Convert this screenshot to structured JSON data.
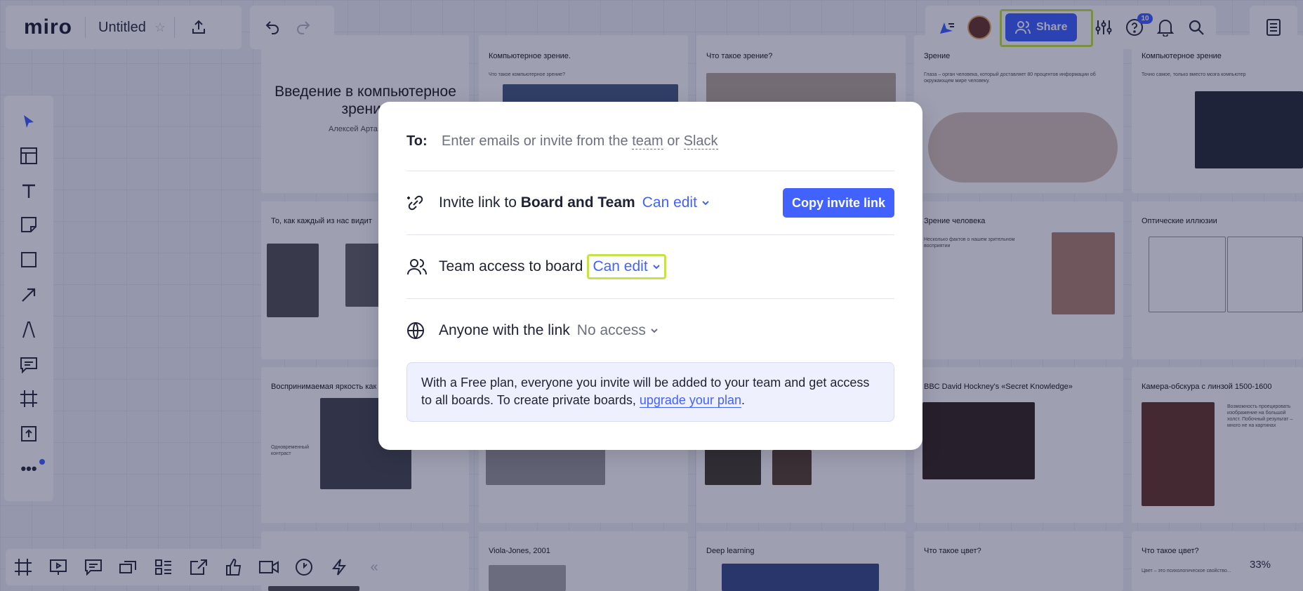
{
  "app": {
    "logo": "miro",
    "board_title": "Untitled",
    "notifications_count": "10",
    "share_label": "Share",
    "zoom": "33%"
  },
  "frames": [
    {
      "title": "Введение в компьютерное зрение",
      "subtitle": "Алексей Арта"
    },
    {
      "title": "Компьютерное зрение.",
      "subtitle": "Что такое компьютерное зрение?"
    },
    {
      "title": "Что такое зрение?"
    },
    {
      "title": "Зрение",
      "subtitle": "Глаза – орган человека, который доставляет 80 процентов информации об окружающем мире человеку."
    },
    {
      "title": "Компьютерное зрение",
      "subtitle": "Точно самое, только вместо мозга компьютер"
    },
    {
      "title": "То, как каждый из нас видит"
    },
    {
      "title": "Зрение человека",
      "subtitle": "Несколько фактов о нашем зрительном восприятии"
    },
    {
      "title": "Оптические иллюзии"
    },
    {
      "title": "Воспринимаемая яркость как фу",
      "subtitle": "Одновременный контраст"
    },
    {
      "title": "BBC David Hockney's «Secret Knowledge»"
    },
    {
      "title": "Камера-обскура с линзой 1500-1600",
      "subtitle": "Возможность проецировать изображение на большой холст. Побочный результат – много не на картинах"
    },
    {
      "title": "Viola-Jones, 2001"
    },
    {
      "title": "Deep learning"
    },
    {
      "title": "Что такое цвет?"
    },
    {
      "title": "Что такое цвет?",
      "subtitle": "Цвет – это психологическое свойство..."
    }
  ],
  "dialog": {
    "to_label": "To:",
    "to_placeholder_prefix": "Enter emails or invite from the",
    "to_team_link": "team",
    "to_or": "or",
    "to_slack_link": "Slack",
    "invite_prefix": "Invite link to",
    "invite_target": "Board and Team",
    "invite_permission": "Can edit",
    "copy_button": "Copy invite link",
    "team_access_label": "Team access to board",
    "team_permission": "Can edit",
    "anyone_label": "Anyone with the link",
    "anyone_permission": "No access",
    "info_text": "With a Free plan, everyone you invite will be added to your team and get access to all boards. To create private boards,",
    "info_link": "upgrade your plan",
    "info_end": "."
  },
  "colors": {
    "accent": "#4262ff",
    "highlight": "#c5e24b",
    "overlay": "rgba(13,18,63,0.40)"
  }
}
